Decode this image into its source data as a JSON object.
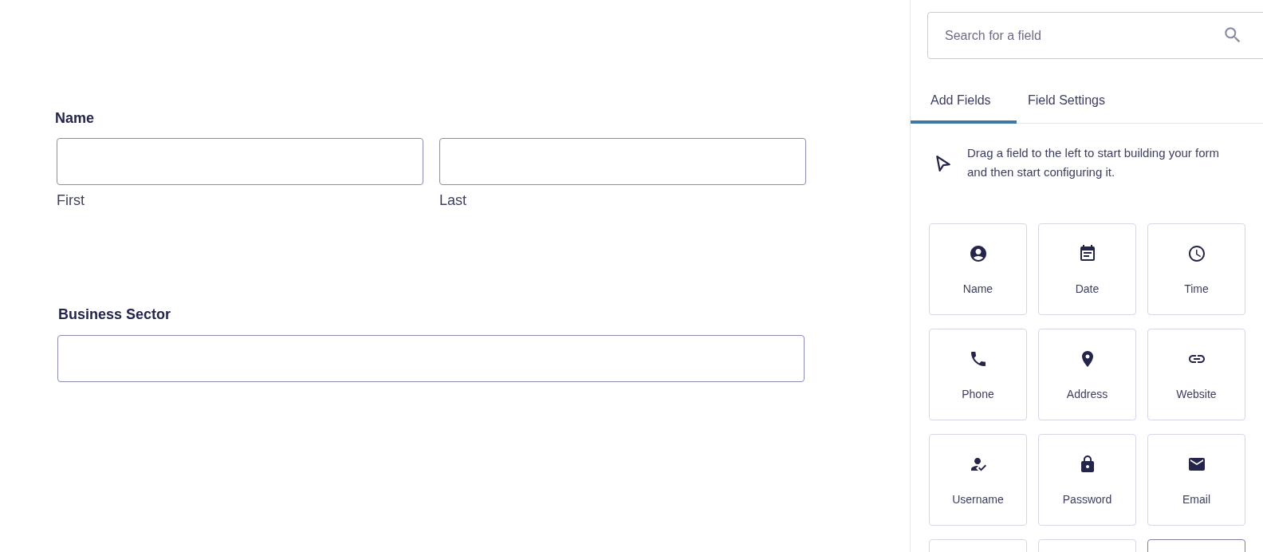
{
  "form": {
    "fields": [
      {
        "label": "Name",
        "kind": "split",
        "parts": [
          "First",
          "Last"
        ]
      },
      {
        "label": "Business Sector",
        "kind": "single"
      }
    ]
  },
  "sidebar": {
    "search": {
      "placeholder": "Search for a field"
    },
    "tabs": [
      {
        "label": "Add Fields",
        "selected": true
      },
      {
        "label": "Field Settings",
        "selected": false
      }
    ],
    "hint": "Drag a field to the left to start building your form and then start configuring it.",
    "tiles": [
      {
        "kind": "tile",
        "label": "Name",
        "hovered": false
      },
      {
        "kind": "tile",
        "label": "Date",
        "hovered": false
      },
      {
        "kind": "tile",
        "label": "Time",
        "hovered": false
      },
      {
        "kind": "tile",
        "label": "Phone",
        "hovered": false
      },
      {
        "kind": "tile",
        "label": "Address",
        "hovered": false
      },
      {
        "kind": "tile",
        "label": "Website",
        "hovered": false
      },
      {
        "kind": "tile",
        "label": "Username",
        "hovered": false
      },
      {
        "kind": "tile",
        "label": "Password",
        "hovered": false
      },
      {
        "kind": "tile",
        "label": "Email",
        "hovered": false
      },
      {
        "kind": "cut",
        "hovered": false
      },
      {
        "kind": "cut",
        "hovered": false
      },
      {
        "kind": "cut",
        "hovered": true
      }
    ]
  }
}
